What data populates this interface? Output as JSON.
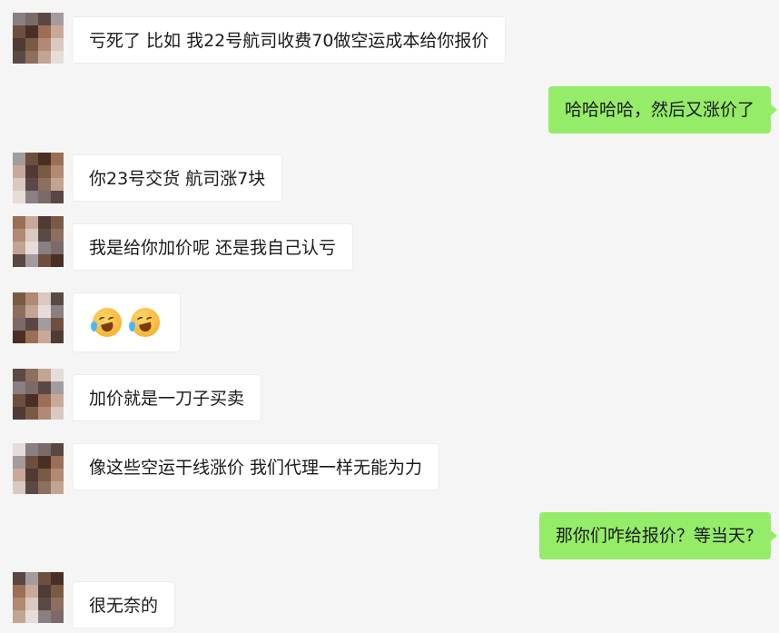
{
  "messages": [
    {
      "side": "in",
      "text": "亏死了 比如 我22号航司收费70做空运成本给你报价"
    },
    {
      "side": "out",
      "text": "哈哈哈哈，然后又涨价了"
    },
    {
      "side": "in",
      "text": "你23号交货  航司涨7块"
    },
    {
      "side": "in",
      "text": "我是给你加价呢 还是我自己认亏"
    },
    {
      "side": "in",
      "emoji": [
        "laughing-crying-emoji",
        "laughing-crying-emoji"
      ]
    },
    {
      "side": "in",
      "text": "加价就是一刀子买卖"
    },
    {
      "side": "in",
      "text": "像这些空运干线涨价 我们代理一样无能为力"
    },
    {
      "side": "out",
      "text": "那你们咋给报价？等当天?"
    },
    {
      "side": "in",
      "text": "很无奈的"
    }
  ],
  "colors": {
    "background": "#f5f5f5",
    "incoming_bubble": "#ffffff",
    "outgoing_bubble": "#95ec69"
  }
}
